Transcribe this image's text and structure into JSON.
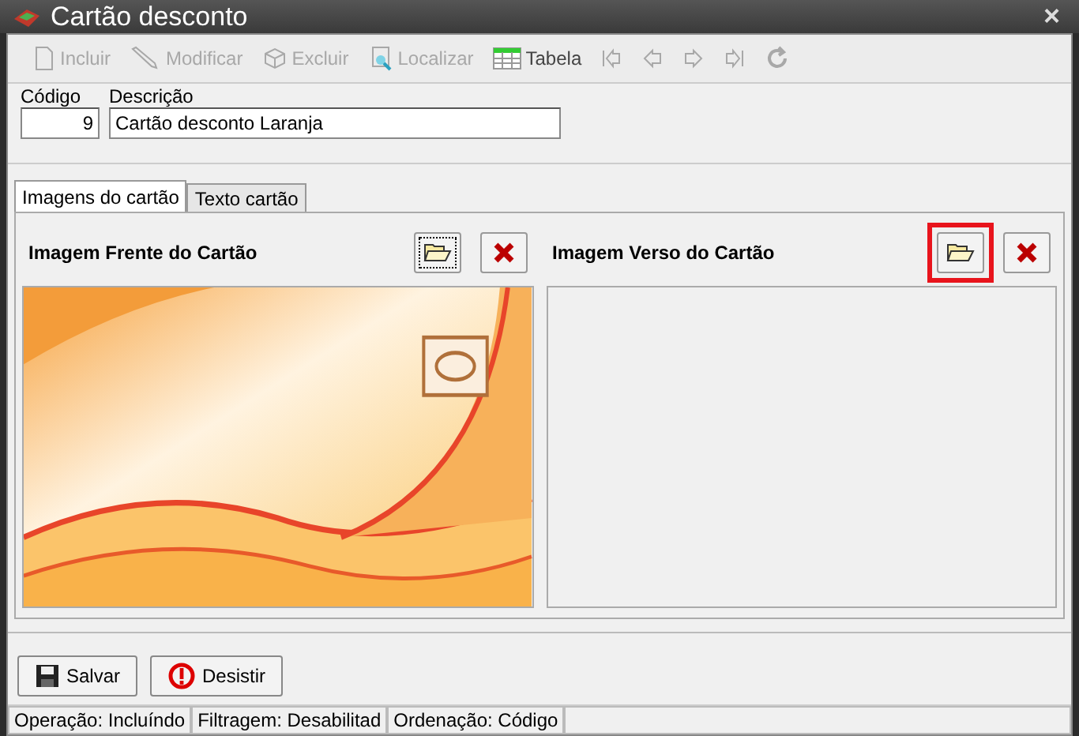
{
  "window": {
    "title": "Cartão desconto",
    "close": "×"
  },
  "toolbar": [
    {
      "kind": "page",
      "label": "Incluir",
      "disabled": true
    },
    {
      "kind": "pencil",
      "label": "Modificar",
      "disabled": true
    },
    {
      "kind": "cube",
      "label": "Excluir",
      "disabled": true
    },
    {
      "kind": "find",
      "label": "Localizar",
      "disabled": true
    },
    {
      "kind": "grid",
      "label": "Tabela",
      "disabled": false
    },
    {
      "kind": "first",
      "disabled": true
    },
    {
      "kind": "prev",
      "disabled": true
    },
    {
      "kind": "next",
      "disabled": true
    },
    {
      "kind": "last",
      "disabled": true
    },
    {
      "kind": "refresh",
      "disabled": true
    }
  ],
  "fields": [
    {
      "kind": "code",
      "label": "Código",
      "value": "9"
    },
    {
      "kind": "desc",
      "label": "Descrição",
      "value": "Cartão desconto Laranja"
    }
  ],
  "tabs": [
    {
      "label": "Imagens do cartão",
      "selected": true
    },
    {
      "label": "Texto cartão",
      "selected": false
    }
  ],
  "images": [
    {
      "title": "Imagem Frente do Cartão",
      "highlighted": false,
      "focused": true,
      "kind": "picture"
    },
    {
      "title": "Imagem Verso do Cartão",
      "highlighted": true,
      "focused": false,
      "kind": "empty"
    }
  ],
  "buttons": [
    {
      "kind": "save",
      "label": "Salvar"
    },
    {
      "kind": "cancel",
      "label": "Desistir"
    }
  ],
  "status_bar": [
    "Operação: Incluíndo",
    "Filtragem: Desabilitad",
    "Ordenação: Código"
  ]
}
